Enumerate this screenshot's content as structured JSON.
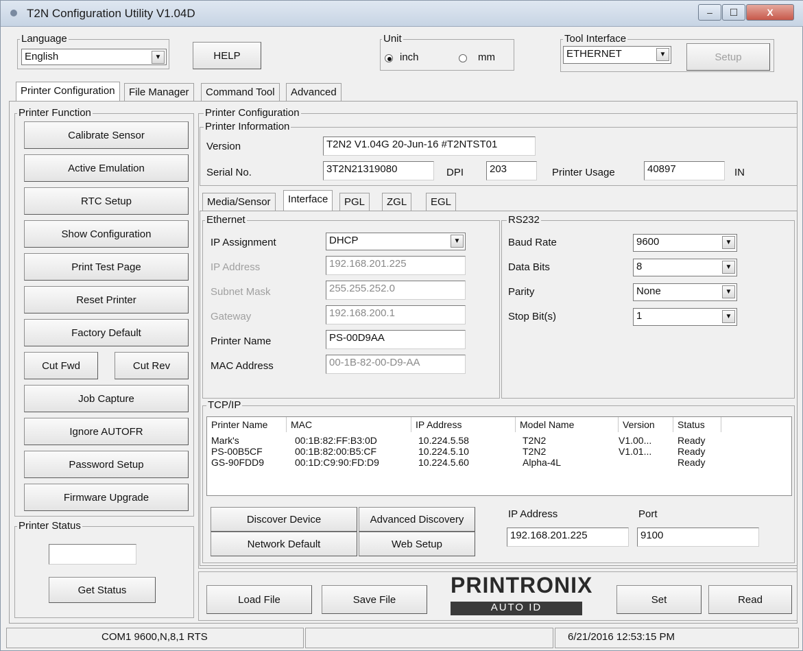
{
  "window": {
    "title": "T2N Configuration Utility V1.04D",
    "minimize": "–",
    "maximize": "☐",
    "close": "X"
  },
  "language": {
    "label": "Language",
    "value": "English"
  },
  "help_label": "HELP",
  "unit": {
    "label": "Unit",
    "inch": "inch",
    "mm": "mm",
    "selected": "inch"
  },
  "tool_interface": {
    "label": "Tool Interface",
    "value": "ETHERNET",
    "setup": "Setup"
  },
  "tabs": [
    "Printer Configuration",
    "File Manager",
    "Command Tool",
    "Advanced"
  ],
  "printer_function": {
    "label": "Printer Function",
    "buttons": [
      "Calibrate Sensor",
      "Active Emulation",
      "RTC Setup",
      "Show Configuration",
      "Print Test Page",
      "Reset Printer",
      "Factory Default"
    ],
    "cut_fwd": "Cut Fwd",
    "cut_rev": "Cut Rev",
    "buttons2": [
      "Job Capture",
      "Ignore AUTOFR",
      "Password Setup",
      "Firmware Upgrade"
    ]
  },
  "printer_status": {
    "label": "Printer Status",
    "value": "",
    "get_status": "Get Status"
  },
  "printer_config": {
    "label": "Printer Configuration",
    "info_label": "Printer Information",
    "version_label": "Version",
    "version": "T2N2 V1.04G 20-Jun-16 #T2NTST01",
    "serial_label": "Serial No.",
    "serial": "3T2N21319080",
    "dpi_label": "DPI",
    "dpi": "203",
    "usage_label": "Printer Usage",
    "usage": "40897",
    "usage_unit": "IN"
  },
  "subtabs": [
    "Media/Sensor",
    "Interface",
    "PGL",
    "ZGL",
    "EGL"
  ],
  "ethernet": {
    "label": "Ethernet",
    "ip_assignment_label": "IP Assignment",
    "ip_assignment": "DHCP",
    "ip_address_label": "IP Address",
    "ip_address": "192.168.201.225",
    "subnet_label": "Subnet Mask",
    "subnet": "255.255.252.0",
    "gateway_label": "Gateway",
    "gateway": "192.168.200.1",
    "printer_name_label": "Printer Name",
    "printer_name": "PS-00D9AA",
    "mac_label": "MAC Address",
    "mac": "00-1B-82-00-D9-AA"
  },
  "rs232": {
    "label": "RS232",
    "baud_label": "Baud Rate",
    "baud": "9600",
    "databits_label": "Data Bits",
    "databits": "8",
    "parity_label": "Parity",
    "parity": "None",
    "stopbits_label": "Stop Bit(s)",
    "stopbits": "1"
  },
  "tcpip": {
    "label": "TCP/IP",
    "columns": [
      "Printer Name",
      "MAC",
      "IP Address",
      "Model Name",
      "Version",
      "Status"
    ],
    "rows": [
      [
        "Mark's",
        "00:1B:82:FF:B3:0D",
        "10.224.5.58",
        "T2N2",
        "V1.00...",
        "Ready"
      ],
      [
        "PS-00B5CF",
        "00:1B:82:00:B5:CF",
        "10.224.5.10",
        "T2N2",
        "V1.01...",
        "Ready"
      ],
      [
        "GS-90FDD9",
        "00:1D:C9:90:FD:D9",
        "10.224.5.60",
        "Alpha-4L",
        "",
        "Ready"
      ]
    ],
    "discover": "Discover Device",
    "advanced_discovery": "Advanced Discovery",
    "network_default": "Network Default",
    "web_setup": "Web Setup",
    "ip_label": "IP Address",
    "ip": "192.168.201.225",
    "port_label": "Port",
    "port": "9100"
  },
  "bottom": {
    "load": "Load File",
    "save": "Save File",
    "set": "Set",
    "read": "Read",
    "logo": "PRINTRONIX",
    "logo_sub": "AUTO ID"
  },
  "statusbar": {
    "port": "COM1 9600,N,8,1 RTS",
    "middle": "",
    "datetime": "6/21/2016 12:53:15 PM"
  }
}
